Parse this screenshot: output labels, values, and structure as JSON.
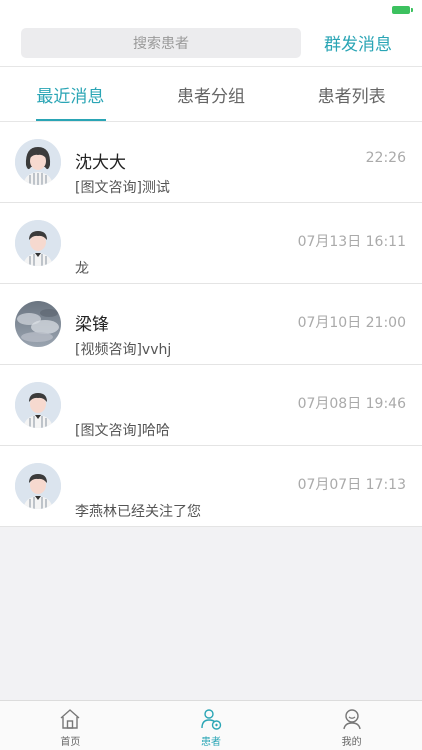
{
  "header": {
    "search_placeholder": "搜索患者",
    "mass_message_button": "群发消息"
  },
  "tabs": [
    {
      "label": "最近消息",
      "active": true
    },
    {
      "label": "患者分组",
      "active": false
    },
    {
      "label": "患者列表",
      "active": false
    }
  ],
  "messages": [
    {
      "name": "沈大大",
      "time": "22:26",
      "preview": "[图文咨询]测试",
      "avatar": "female-avatar"
    },
    {
      "name": "",
      "time": "07月13日 16:11",
      "preview": "龙",
      "avatar": "male-avatar"
    },
    {
      "name": "梁锋",
      "time": "07月10日 21:00",
      "preview": "[视频咨询]vvhj",
      "avatar": "sky-photo-avatar"
    },
    {
      "name": "",
      "time": "07月08日 19:46",
      "preview": "[图文咨询]哈哈",
      "avatar": "male-avatar"
    },
    {
      "name": "",
      "time": "07月07日 17:13",
      "preview": "李燕林已经关注了您",
      "avatar": "male-avatar"
    }
  ],
  "tabbar": [
    {
      "label": "首页",
      "icon": "home-icon",
      "active": false
    },
    {
      "label": "患者",
      "icon": "patient-icon",
      "active": true
    },
    {
      "label": "我的",
      "icon": "profile-icon",
      "active": false
    }
  ],
  "colors": {
    "accent": "#2aa5b5",
    "battery": "#3cc15f"
  }
}
